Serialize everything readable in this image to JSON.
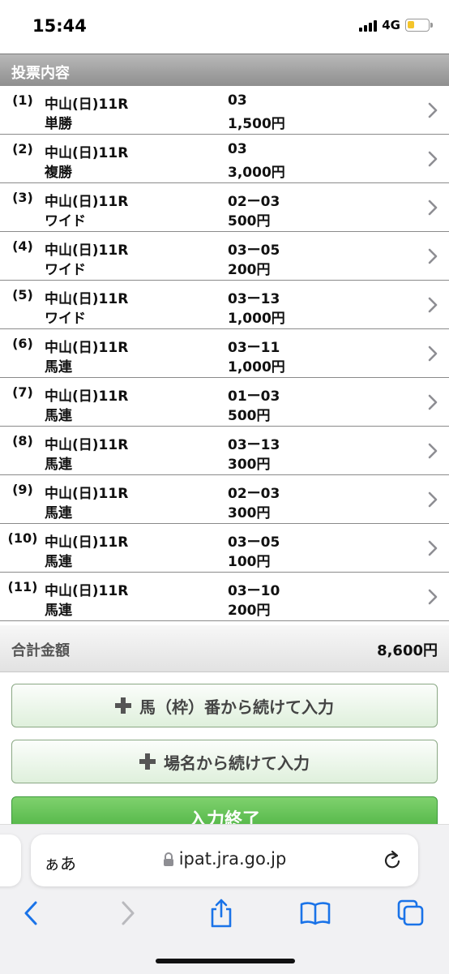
{
  "status": {
    "time": "15:44",
    "network": "4G",
    "battery_level": 0.35,
    "battery_color": "#f4c42a"
  },
  "section": {
    "title": "投票内容"
  },
  "bets": [
    {
      "index": "(1)",
      "venue": "中山(日)11R",
      "type": "単勝",
      "combo": "03",
      "amount": "1,500円"
    },
    {
      "index": "(2)",
      "venue": "中山(日)11R",
      "type": "複勝",
      "combo": "03",
      "amount": "3,000円"
    },
    {
      "index": "(3)",
      "venue": "中山(日)11R",
      "type": "ワイド",
      "combo": "02ー03",
      "amount": "500円"
    },
    {
      "index": "(4)",
      "venue": "中山(日)11R",
      "type": "ワイド",
      "combo": "03ー05",
      "amount": "200円"
    },
    {
      "index": "(5)",
      "venue": "中山(日)11R",
      "type": "ワイド",
      "combo": "03ー13",
      "amount": "1,000円"
    },
    {
      "index": "(6)",
      "venue": "中山(日)11R",
      "type": "馬連",
      "combo": "03ー11",
      "amount": "1,000円"
    },
    {
      "index": "(7)",
      "venue": "中山(日)11R",
      "type": "馬連",
      "combo": "01ー03",
      "amount": "500円"
    },
    {
      "index": "(8)",
      "venue": "中山(日)11R",
      "type": "馬連",
      "combo": "03ー13",
      "amount": "300円"
    },
    {
      "index": "(9)",
      "venue": "中山(日)11R",
      "type": "馬連",
      "combo": "02ー03",
      "amount": "300円"
    },
    {
      "index": "(10)",
      "venue": "中山(日)11R",
      "type": "馬連",
      "combo": "03ー05",
      "amount": "100円"
    },
    {
      "index": "(11)",
      "venue": "中山(日)11R",
      "type": "馬連",
      "combo": "03ー10",
      "amount": "200円"
    }
  ],
  "total": {
    "label": "合計金額",
    "value": "8,600円"
  },
  "buttons": {
    "continue_horse": "馬（枠）番から続けて入力",
    "continue_venue": "場名から続けて入力",
    "finish": "入力終了"
  },
  "browser": {
    "aa": "ぁあ",
    "url": "ipat.jra.go.jp"
  },
  "icons": {
    "row_chevron": "chevron-right-icon",
    "plus": "plus-icon",
    "lock": "lock-icon",
    "reload": "reload-icon",
    "back": "back-icon",
    "forward": "forward-icon",
    "share": "share-icon",
    "bookmarks": "bookmarks-icon",
    "tabs": "tabs-icon"
  },
  "colors": {
    "accent_green": "#43ad3a",
    "ios_blue": "#1a73e8",
    "header_gray": "#8f8f8f"
  }
}
